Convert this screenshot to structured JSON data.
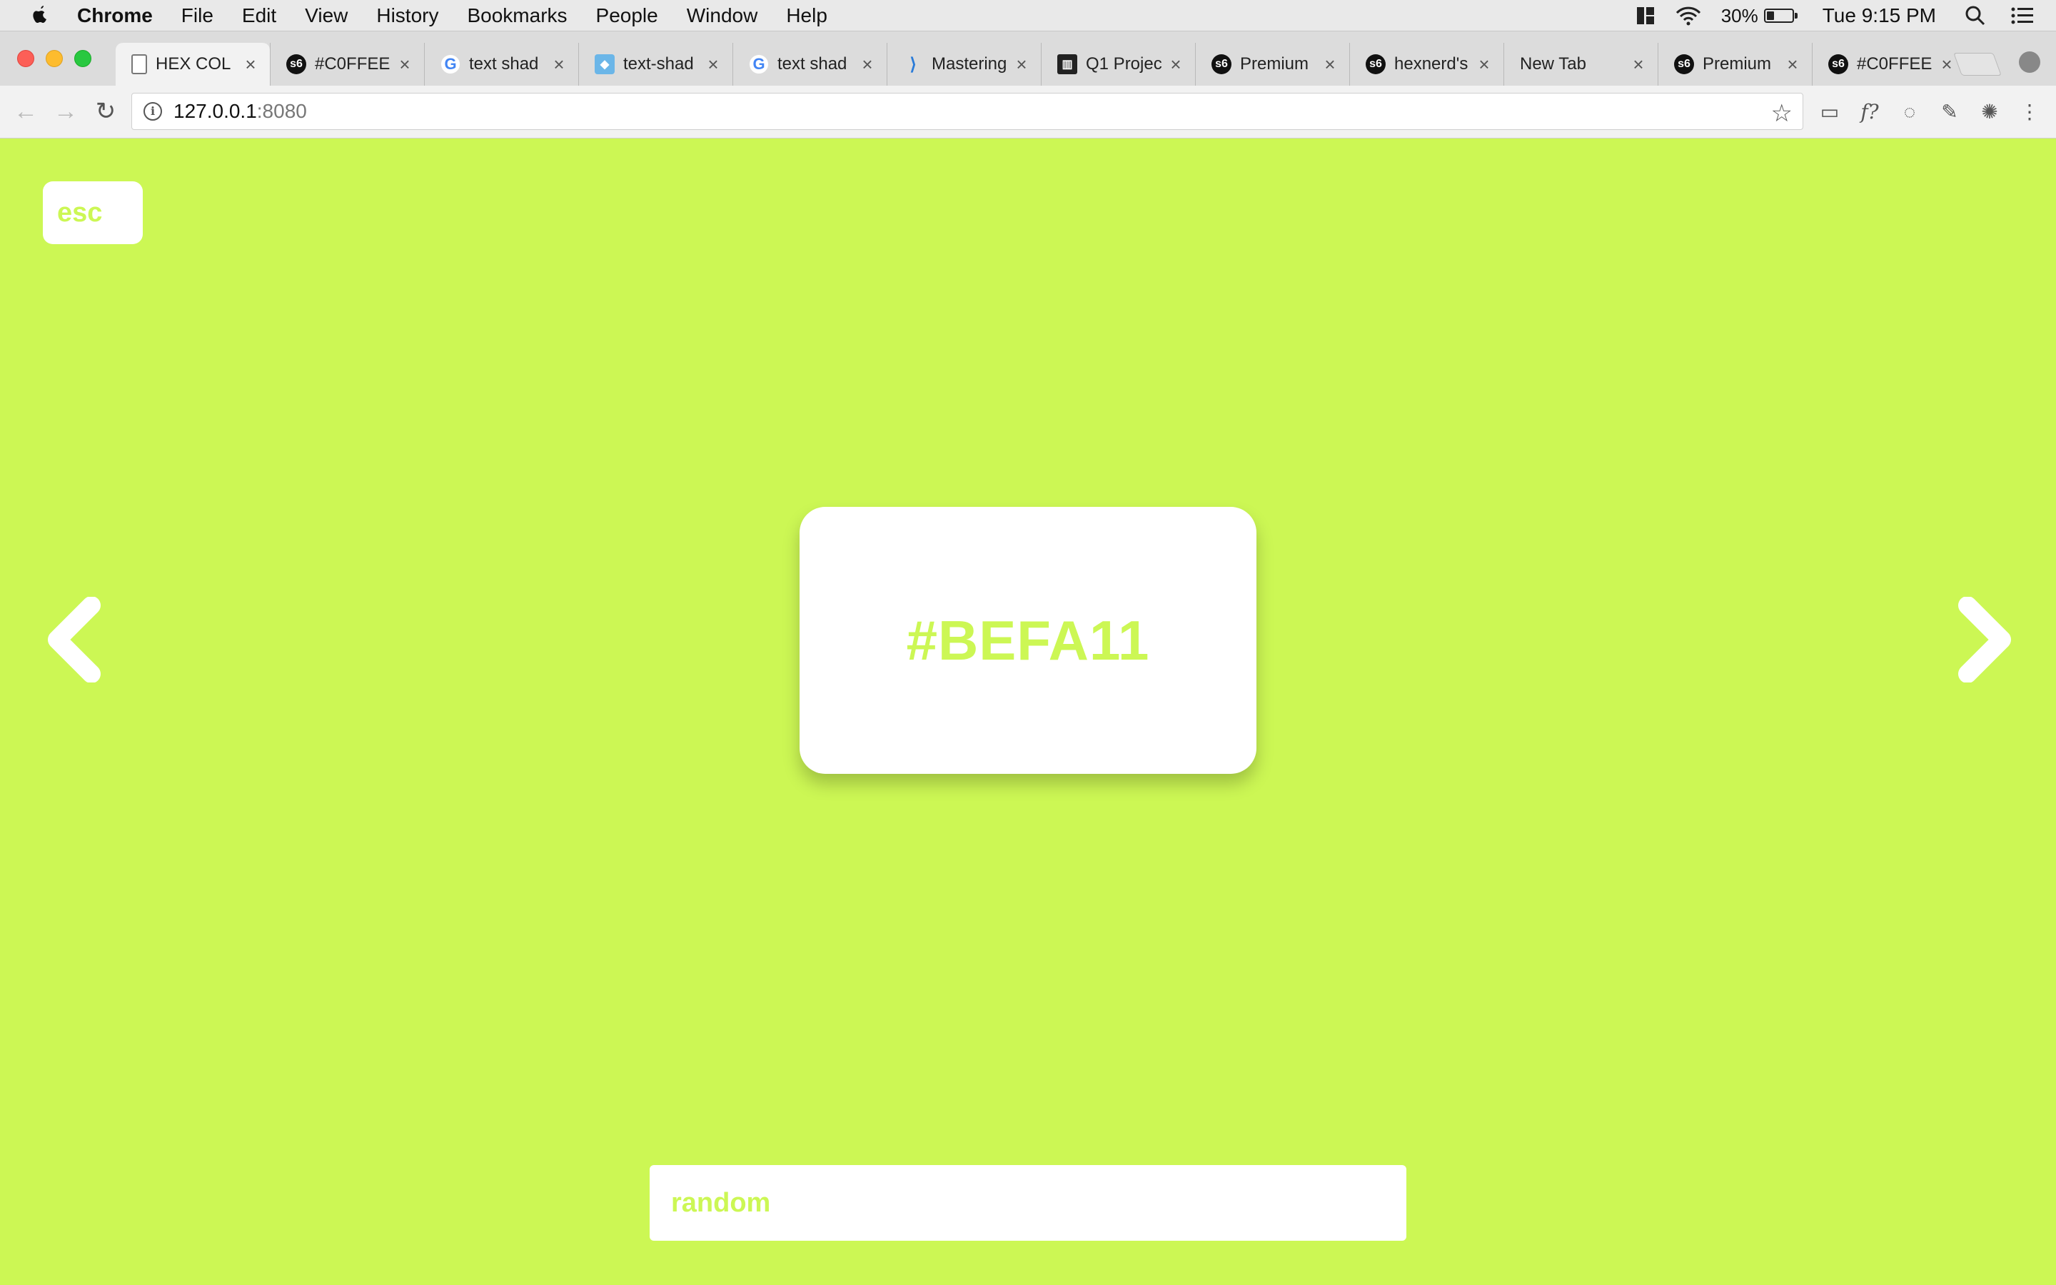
{
  "menubar": {
    "app_name": "Chrome",
    "menus": [
      "File",
      "Edit",
      "View",
      "History",
      "Bookmarks",
      "People",
      "Window",
      "Help"
    ],
    "battery_percent": "30%",
    "battery_level": 0.3,
    "clock": "Tue 9:15 PM"
  },
  "tabs": [
    {
      "title": "HEX COL",
      "favicon": "document-icon",
      "active": true
    },
    {
      "title": "#C0FFEE",
      "favicon": "s6-icon",
      "active": false
    },
    {
      "title": "text shad",
      "favicon": "google-icon",
      "active": false
    },
    {
      "title": "text-shad",
      "favicon": "bird-icon",
      "active": false
    },
    {
      "title": "text shad",
      "favicon": "google-icon",
      "active": false
    },
    {
      "title": "Mastering",
      "favicon": "mastering-icon",
      "active": false
    },
    {
      "title": "Q1 Projec",
      "favicon": "q1-icon",
      "active": false
    },
    {
      "title": "Premium",
      "favicon": "s6-icon",
      "active": false
    },
    {
      "title": "hexnerd's",
      "favicon": "s6-icon",
      "active": false
    },
    {
      "title": "New Tab",
      "favicon": "",
      "active": false
    },
    {
      "title": "Premium",
      "favicon": "s6-icon",
      "active": false
    },
    {
      "title": "#C0FFEE",
      "favicon": "s6-icon",
      "active": false
    }
  ],
  "address_bar": {
    "host": "127.0.0.1",
    "port": ":8080"
  },
  "page": {
    "background_color": "#CCF754",
    "esc_label": "esc",
    "hex_code": "#BEFA11",
    "random_label": "random"
  }
}
